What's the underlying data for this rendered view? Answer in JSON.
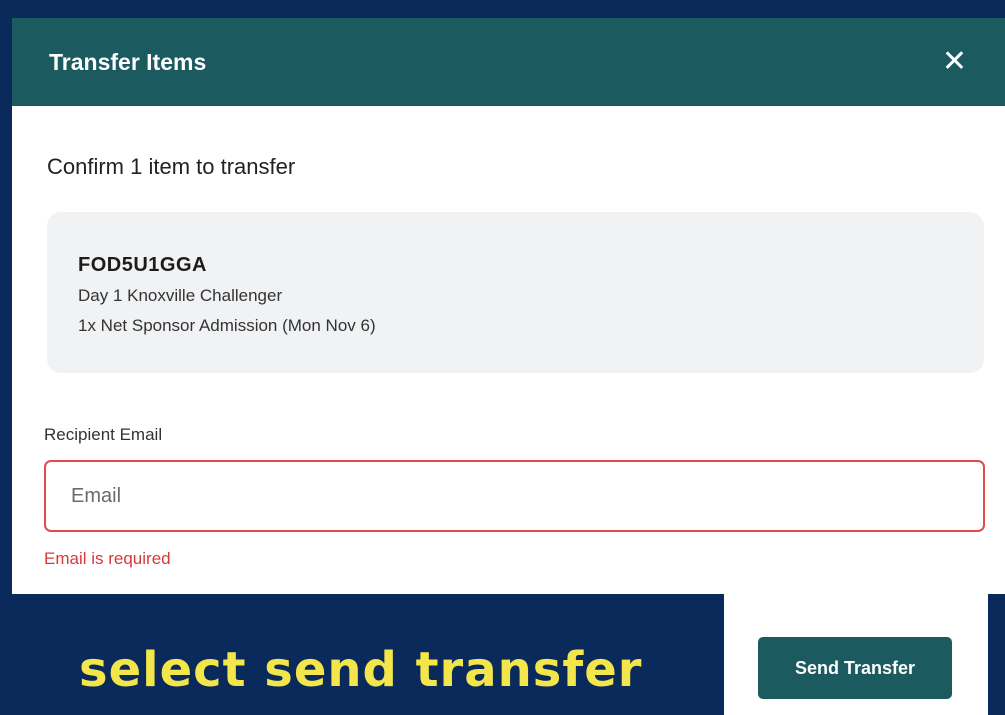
{
  "modal": {
    "title": "Transfer Items",
    "close_symbol": "✕",
    "confirm_heading": "Confirm 1 item to transfer",
    "item": {
      "code": "FOD5U1GGA",
      "event": "Day 1 Knoxville Challenger",
      "description": "1x Net Sponsor Admission (Mon Nov 6)"
    },
    "recipient_label": "Recipient Email",
    "email_placeholder": "Email",
    "email_value": "",
    "error_message": "Email is required",
    "send_button_label": "Send Transfer"
  },
  "caption": "select send transfer",
  "colors": {
    "background": "#0a2a5c",
    "header": "#1b5a5e",
    "error": "#d9383a",
    "caption": "#f3e64a"
  },
  "icons": {
    "close": "close-icon"
  }
}
